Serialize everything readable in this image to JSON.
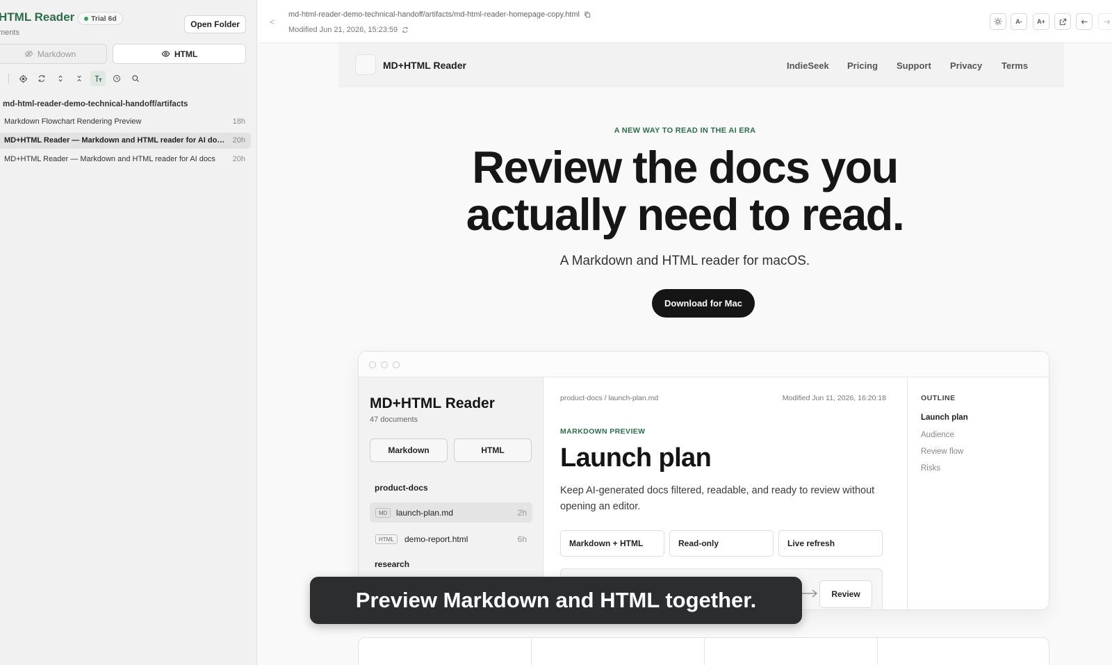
{
  "sidebar": {
    "title": "HTML Reader",
    "badge": "Trial 6d",
    "subtitle": "ments",
    "open_folder": "Open Folder",
    "mode_markdown": "Markdown",
    "mode_html": "HTML",
    "tools": [
      "locate-icon",
      "refresh-icon",
      "expand-icon",
      "collapse-icon",
      "text-size-icon",
      "history-icon",
      "search-icon"
    ],
    "folder": "md-html-reader-demo-technical-handoff/artifacts",
    "files": [
      {
        "title": "Markdown Flowchart Rendering Preview",
        "age": "18h"
      },
      {
        "title": "MD+HTML Reader — Markdown and HTML reader for AI docs on macOS",
        "age": "20h"
      },
      {
        "title": "MD+HTML Reader — Markdown and HTML reader for AI docs",
        "age": "20h"
      }
    ]
  },
  "topbar": {
    "back": "<",
    "path": "md-html-reader-demo-technical-handoff/artifacts/md-html-reader-homepage-copy.html",
    "modified": "Modified Jun 21, 2026, 15:23:59",
    "font_smaller": "A-",
    "font_larger": "A+"
  },
  "web": {
    "brand": "MD+HTML Reader",
    "nav": [
      "IndieSeek",
      "Pricing",
      "Support",
      "Privacy",
      "Terms"
    ],
    "eyebrow": "A NEW WAY TO READ IN THE AI ERA",
    "hero_line1": "Review the docs you",
    "hero_line2": "actually need to read.",
    "subheading": "A Markdown and HTML reader for macOS.",
    "cta": "Download for Mac",
    "mock": {
      "title": "MD+HTML Reader",
      "count": "47 documents",
      "mode_markdown": "Markdown",
      "mode_html": "HTML",
      "folder": "product-docs",
      "files": [
        {
          "tag": "MD",
          "name": "launch-plan.md",
          "age": "2h"
        },
        {
          "tag": "HTML",
          "name": "demo-report.html",
          "age": "6h"
        }
      ],
      "folder2": "research",
      "breadcrumb": "product-docs / launch-plan.md",
      "modified": "Modified Jun 11, 2026, 16:20:18",
      "label": "MARKDOWN PREVIEW",
      "heading": "Launch plan",
      "paragraph": "Keep AI-generated docs filtered, readable, and ready to review without opening an editor.",
      "pills": [
        "Markdown + HTML",
        "Read-only",
        "Live refresh"
      ],
      "flow_review": "Review",
      "outline_head": "OUTLINE",
      "outline": [
        "Launch plan",
        "Audience",
        "Review flow",
        "Risks"
      ]
    }
  },
  "caption": "Preview Markdown and HTML together.",
  "colors": {
    "accent_green": "#2e6b4a",
    "dark_button": "#151515",
    "caption_bg": "#2b2d2f"
  }
}
